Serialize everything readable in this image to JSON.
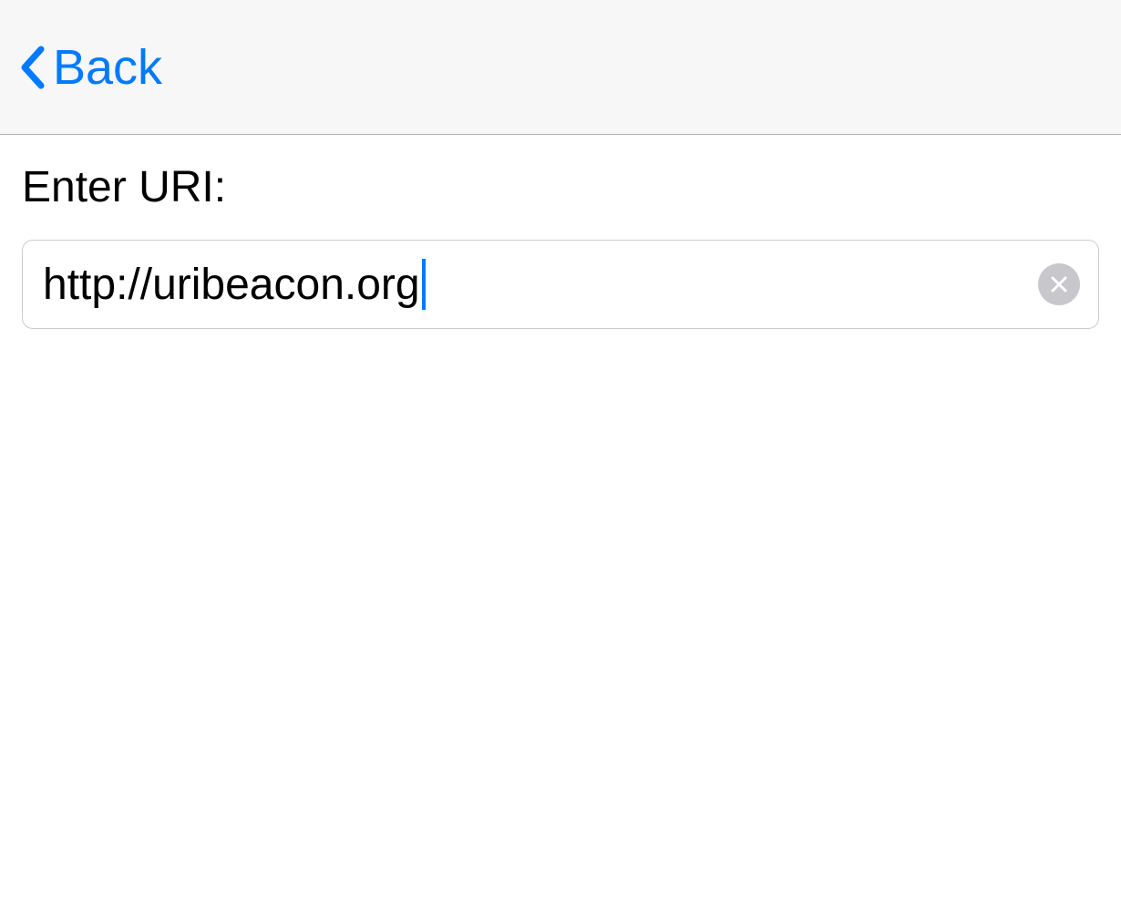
{
  "nav": {
    "back_label": "Back"
  },
  "form": {
    "uri_label": "Enter URI:",
    "uri_value": "http://uribeacon.org",
    "uri_placeholder": ""
  },
  "colors": {
    "accent": "#007aff",
    "nav_bg": "#f7f7f7",
    "border": "#cccccc",
    "clear_bg": "#c7c7cc"
  }
}
